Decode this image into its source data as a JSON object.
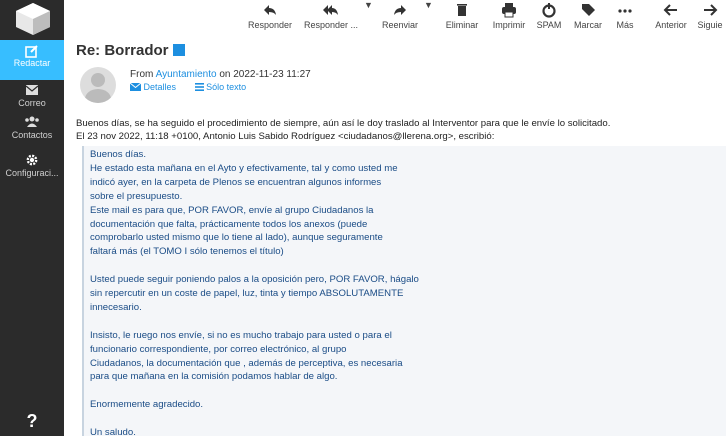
{
  "sidebar": {
    "items": [
      {
        "label": "Redactar",
        "icon": "compose-icon"
      },
      {
        "label": "Correo",
        "icon": "mail-icon"
      },
      {
        "label": "Contactos",
        "icon": "contacts-icon"
      },
      {
        "label": "Configuraci...",
        "icon": "gear-icon"
      }
    ],
    "help": "?"
  },
  "toolbar": {
    "reply": "Responder",
    "reply_all": "Responder ...",
    "forward": "Reenviar",
    "delete": "Eliminar",
    "print": "Imprimir",
    "spam": "SPAM",
    "mark": "Marcar",
    "more": "Más",
    "previous": "Anterior",
    "next": "Siguie"
  },
  "message": {
    "subject": "Re: Borrador",
    "from_prefix": "From",
    "from_name": "Ayuntamiento",
    "date_text": "on 2022-11-23 11:27",
    "details": "Detalles",
    "plain_text": "Sólo texto",
    "body_line1": "Buenos días, se ha seguido el procedimiento de siempre, aún así le doy traslado al Interventor para que le envíe lo solicitado.",
    "body_line2": "El 23 nov 2022, 11:18 +0100, Antonio Luis Sabido Rodríguez <ciudadanos@llerena.org>, escribió:",
    "quote": [
      "Buenos días.",
      "He estado esta mañana en el Ayto y efectivamente, tal y como usted me",
      "indicó ayer, en la carpeta de Plenos se encuentran algunos informes",
      "sobre el presupuesto.",
      "Este mail es para que, POR FAVOR, envíe al grupo Ciudadanos la",
      "documentación que falta, prácticamente todos los anexos (puede",
      "comprobarlo usted mismo que lo tiene al lado), aunque seguramente",
      "faltará más (el TOMO I sólo tenemos el título)",
      "",
      "Usted puede seguir poniendo palos a la oposición pero, POR FAVOR, hágalo",
      "sin repercutir en un coste de papel, luz, tinta y tiempo ABSOLUTAMENTE",
      "innecesario.",
      "",
      "Insisto, le ruego nos envíe, si no es mucho trabajo para usted o para el",
      "funcionario correspondiente, por correo electrónico, al grupo",
      "Ciudadanos, la documentación que , además de perceptiva, es necesaria",
      "para que mañana en la comisión podamos hablar de algo.",
      "",
      "Enormemente agradecido.",
      "",
      "Un saludo."
    ]
  },
  "colors": {
    "sidebar_bg": "#2b2b2b",
    "active_bg": "#37beff",
    "link": "#1d8fe0",
    "quote_text": "#1a4c86"
  }
}
